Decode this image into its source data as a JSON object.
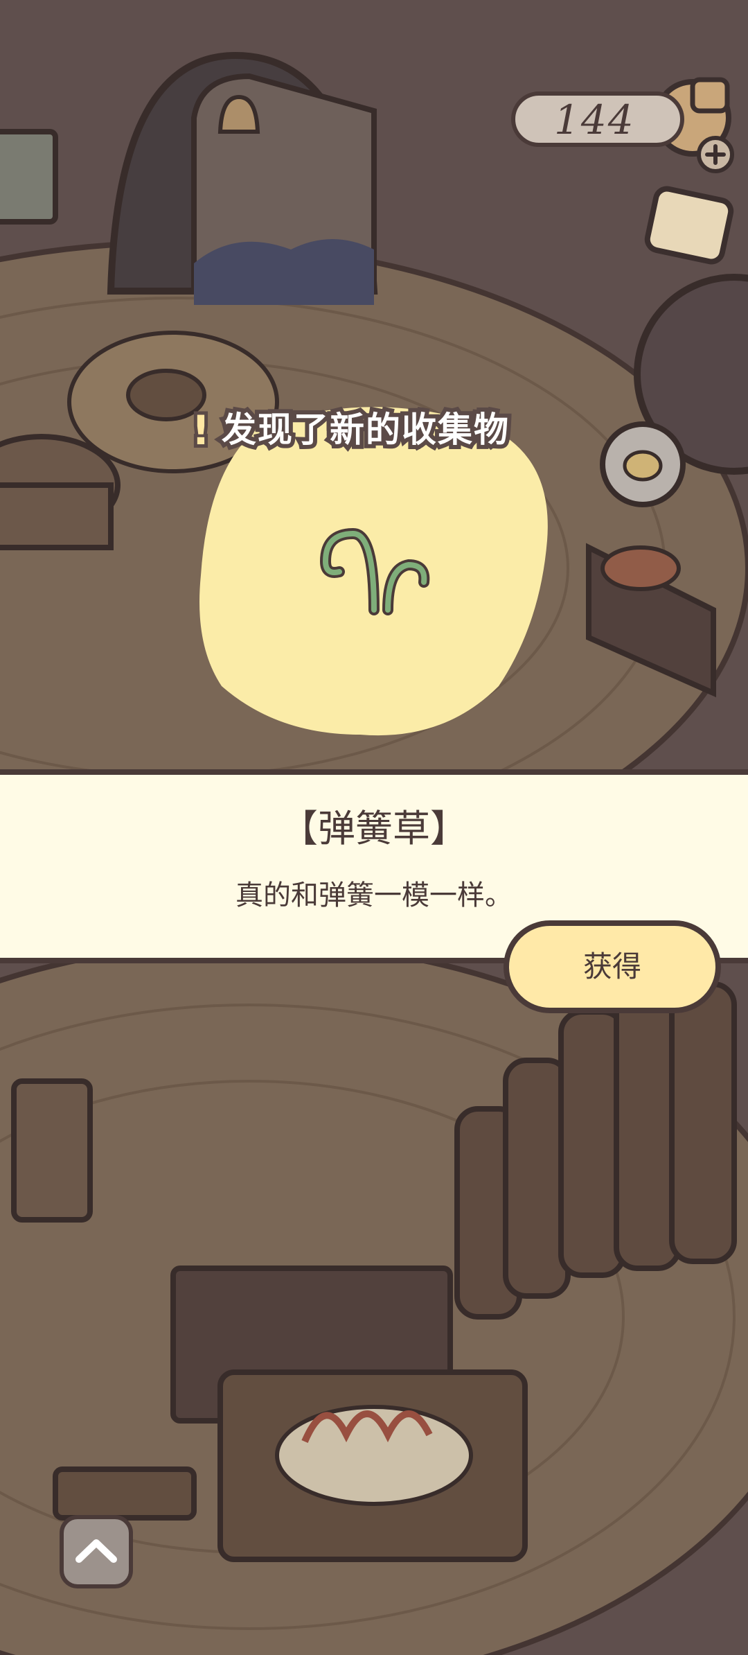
{
  "hud": {
    "currency_value": "144",
    "currency_icon": "clover-pouch-icon",
    "add_icon": "plus-icon",
    "side_icon": "coffee-cup-icon"
  },
  "popup": {
    "discover_text": "发现了新的收集物",
    "item_icon": "spring-grass-icon",
    "item_name": "【弹簧草】",
    "item_description": "真的和弹簧一模一样。",
    "obtain_label": "获得"
  },
  "nav": {
    "up_icon": "chevron-up-icon"
  },
  "colors": {
    "outline": "#4a3a38",
    "banner_bg": "#fffbe6",
    "button_bg": "#ffe9a8",
    "glow": "#fbeca8"
  }
}
